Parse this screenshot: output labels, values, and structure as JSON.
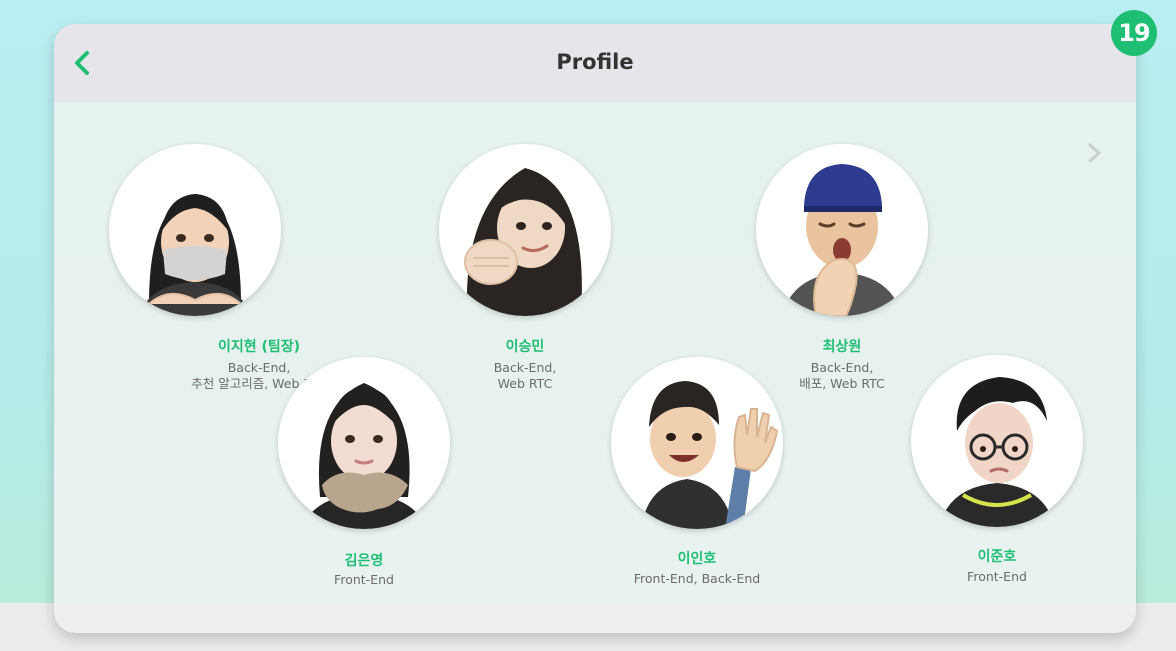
{
  "page_badge": "19",
  "header": {
    "title": "Profile",
    "back_icon": "chevron-left-icon",
    "next_icon": "chevron-right-icon"
  },
  "colors": {
    "accent": "#1fbf73",
    "header_bg": "#e6e6ea",
    "content_bg": "#e8f2f0",
    "role_text": "#6b6b6b"
  },
  "members": [
    {
      "name": "이지현 (팀장)",
      "role_line1": "Back-End,",
      "role_line2": "추천 알고리즘, Web RTC"
    },
    {
      "name": "이승민",
      "role_line1": "Back-End,",
      "role_line2": "Web RTC"
    },
    {
      "name": "최상원",
      "role_line1": "Back-End,",
      "role_line2": "배포, Web RTC"
    },
    {
      "name": "김은영",
      "role_line1": "Front-End",
      "role_line2": ""
    },
    {
      "name": "이인호",
      "role_line1": "Front-End, Back-End",
      "role_line2": ""
    },
    {
      "name": "이준호",
      "role_line1": "Front-End",
      "role_line2": ""
    }
  ]
}
